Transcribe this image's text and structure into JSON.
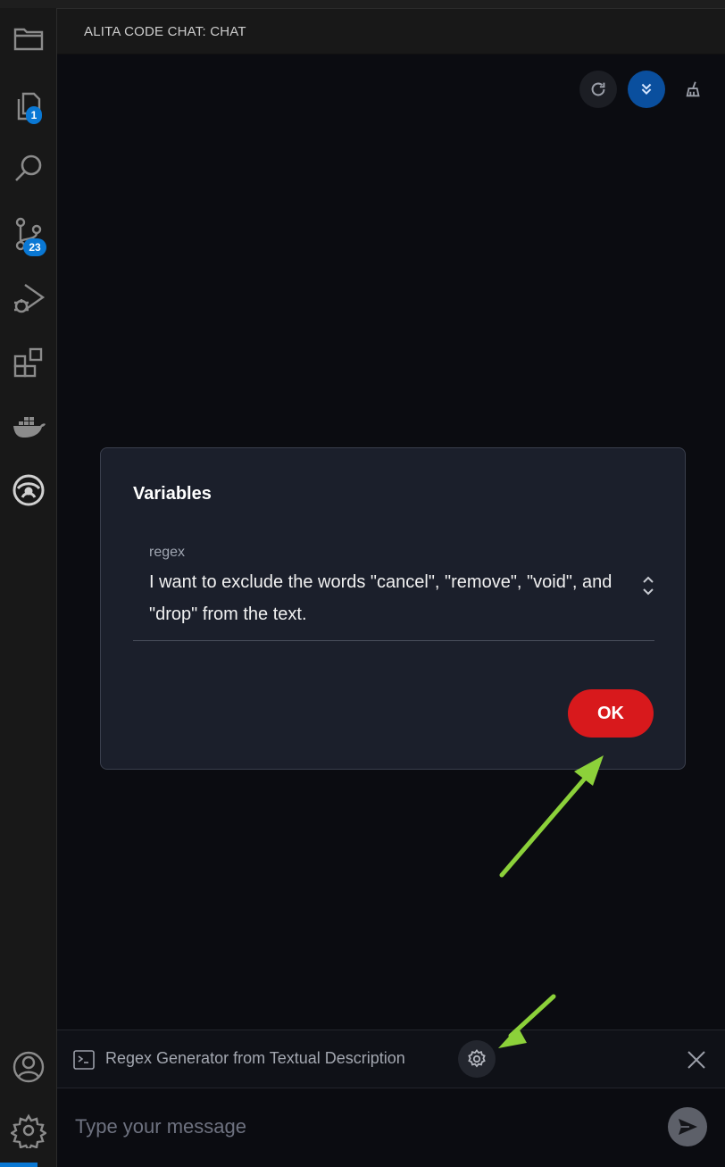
{
  "activity_bar": {
    "items": [
      {
        "icon": "files-icon"
      },
      {
        "icon": "copy-icon",
        "badge": "1"
      },
      {
        "icon": "search-icon"
      },
      {
        "icon": "source-control-icon",
        "badge": "23"
      },
      {
        "icon": "run-debug-icon"
      },
      {
        "icon": "extensions-icon"
      },
      {
        "icon": "docker-icon"
      },
      {
        "icon": "alita-icon"
      }
    ],
    "bottom": [
      {
        "icon": "account-icon"
      },
      {
        "icon": "settings-gear-icon"
      }
    ]
  },
  "panel": {
    "title": "ALITA CODE CHAT: CHAT"
  },
  "toolbar": {
    "buttons": [
      "refresh-icon",
      "scroll-down-icon",
      "clear-chat-icon"
    ],
    "accent": "#0a4f9e"
  },
  "dialog": {
    "title": "Variables",
    "variable_name": "regex",
    "variable_value": "I want to exclude the words \"cancel\", \"remove\", \"void\", and \"drop\" from the text.",
    "ok_label": "OK",
    "ok_color": "#d8191c"
  },
  "prompt_bar": {
    "prompt_name": "Regex Generator from Textual Description"
  },
  "message_input": {
    "placeholder": "Type your message"
  },
  "colors": {
    "annotation_arrow": "#8cd13a",
    "badge": "#0a78d4"
  }
}
